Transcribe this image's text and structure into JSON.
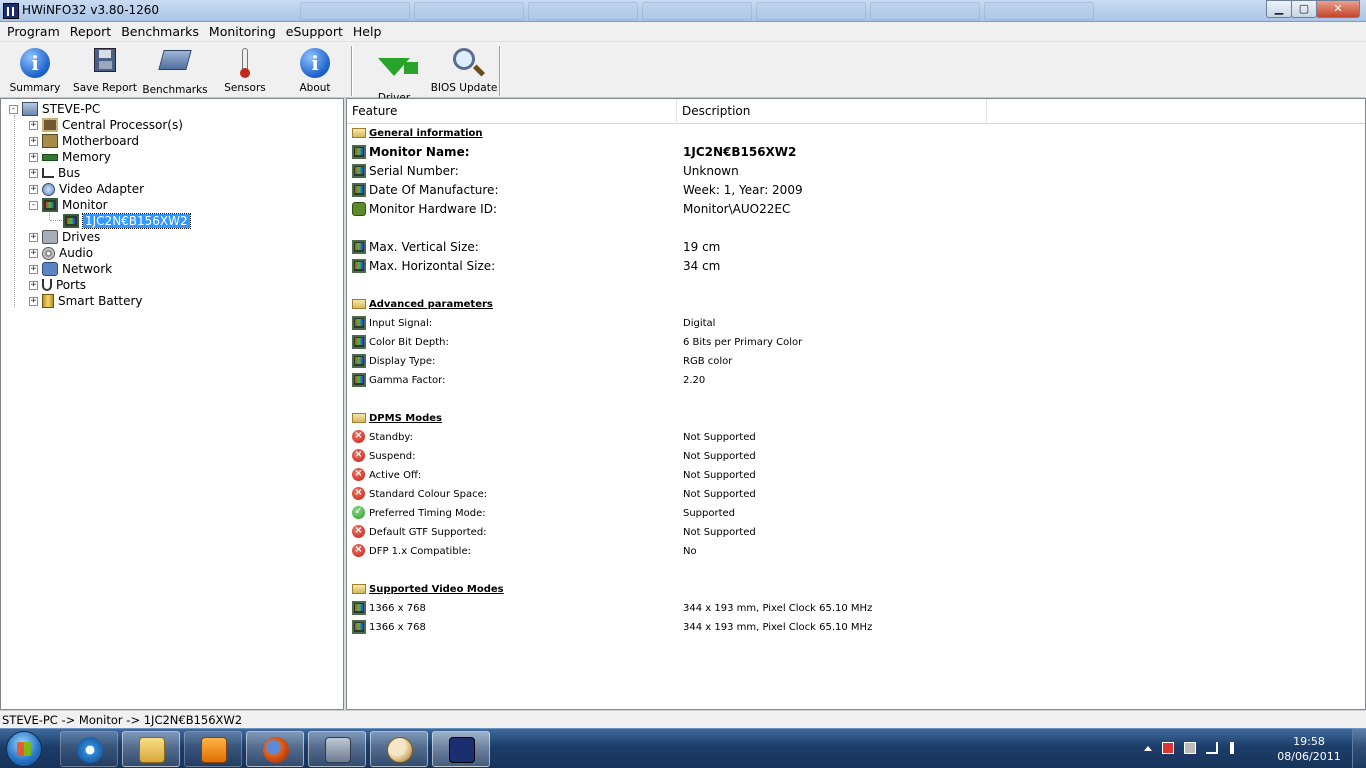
{
  "window": {
    "title": "HWiNFO32 v3.80-1260",
    "controls": {
      "minimize": "▁",
      "maximize": "▢",
      "close": "✕"
    }
  },
  "menu": [
    "Program",
    "Report",
    "Benchmarks",
    "Monitoring",
    "eSupport",
    "Help"
  ],
  "toolbar": {
    "summary": "Summary",
    "save_report": "Save Report",
    "benchmarks": "Benchmarks",
    "sensors": "Sensors",
    "about": "About",
    "driver_update": "Driver Update",
    "bios_update": "BIOS Update"
  },
  "tree": {
    "root": "STEVE-PC",
    "items": [
      {
        "label": "Central Processor(s)",
        "icon": "cpu-icon",
        "expander": "+"
      },
      {
        "label": "Motherboard",
        "icon": "motherboard-icon",
        "expander": "+"
      },
      {
        "label": "Memory",
        "icon": "memory-icon",
        "expander": "+"
      },
      {
        "label": "Bus",
        "icon": "bus-icon",
        "expander": "+"
      },
      {
        "label": "Video Adapter",
        "icon": "video-adapter-icon",
        "expander": "+"
      },
      {
        "label": "Monitor",
        "icon": "monitor-icon",
        "expander": "-"
      },
      {
        "label": "Drives",
        "icon": "drives-icon",
        "expander": "+"
      },
      {
        "label": "Audio",
        "icon": "audio-icon",
        "expander": "+"
      },
      {
        "label": "Network",
        "icon": "network-icon",
        "expander": "+"
      },
      {
        "label": "Ports",
        "icon": "ports-icon",
        "expander": "+"
      },
      {
        "label": "Smart Battery",
        "icon": "battery-icon",
        "expander": "+"
      }
    ],
    "monitor_child": "1JC2N€B156XW2",
    "root_expander": "-"
  },
  "details": {
    "columns": {
      "feature": "Feature",
      "description": "Description"
    },
    "sections": {
      "general": "General information",
      "advanced": "Advanced parameters",
      "dpms": "DPMS Modes",
      "video_modes": "Supported Video Modes"
    },
    "general_rows": [
      {
        "feature": "Monitor Name:",
        "value": "1JC2N€B156XW2"
      },
      {
        "feature": "Serial Number:",
        "value": "Unknown"
      },
      {
        "feature": "Date Of Manufacture:",
        "value": "Week: 1, Year: 2009"
      },
      {
        "feature": "Monitor Hardware ID:",
        "value": "Monitor\\AUO22EC"
      },
      {
        "feature": "Max. Vertical Size:",
        "value": "19 cm"
      },
      {
        "feature": "Max. Horizontal Size:",
        "value": "34 cm"
      }
    ],
    "advanced_rows": [
      {
        "feature": "Input Signal:",
        "value": "Digital"
      },
      {
        "feature": "Color Bit Depth:",
        "value": "6 Bits per Primary Color"
      },
      {
        "feature": "Display Type:",
        "value": "RGB color"
      },
      {
        "feature": "Gamma Factor:",
        "value": "2.20"
      }
    ],
    "dpms_rows": [
      {
        "feature": "Standby:",
        "value": "Not Supported",
        "status": "no"
      },
      {
        "feature": "Suspend:",
        "value": "Not Supported",
        "status": "no"
      },
      {
        "feature": "Active Off:",
        "value": "Not Supported",
        "status": "no"
      },
      {
        "feature": "Standard Colour Space:",
        "value": "Not Supported",
        "status": "no"
      },
      {
        "feature": "Preferred Timing Mode:",
        "value": "Supported",
        "status": "yes"
      },
      {
        "feature": "Default GTF Supported:",
        "value": "Not Supported",
        "status": "no"
      },
      {
        "feature": "DFP 1.x Compatible:",
        "value": "No",
        "status": "no"
      }
    ],
    "video_mode_rows": [
      {
        "feature": "1366 x 768",
        "value": "344 x 193 mm, Pixel Clock 65.10 MHz"
      },
      {
        "feature": "1366 x 768",
        "value": "344 x 193 mm, Pixel Clock 65.10 MHz"
      }
    ]
  },
  "statusbar": {
    "path": "STEVE-PC -> Monitor -> 1JC2N€B156XW2"
  },
  "taskbar": {
    "apps": [
      "internet-explorer-icon",
      "windows-explorer-icon",
      "media-player-icon",
      "firefox-icon",
      "monitor-app-icon",
      "paint-icon",
      "hwinfo-icon"
    ],
    "clock": {
      "time": "19:58",
      "date": "08/06/2011"
    }
  },
  "colors": {
    "selection": "#3399ff",
    "taskbar": "#1c3d69",
    "supported": "#1e9a1e",
    "unsupported": "#c41a10"
  }
}
